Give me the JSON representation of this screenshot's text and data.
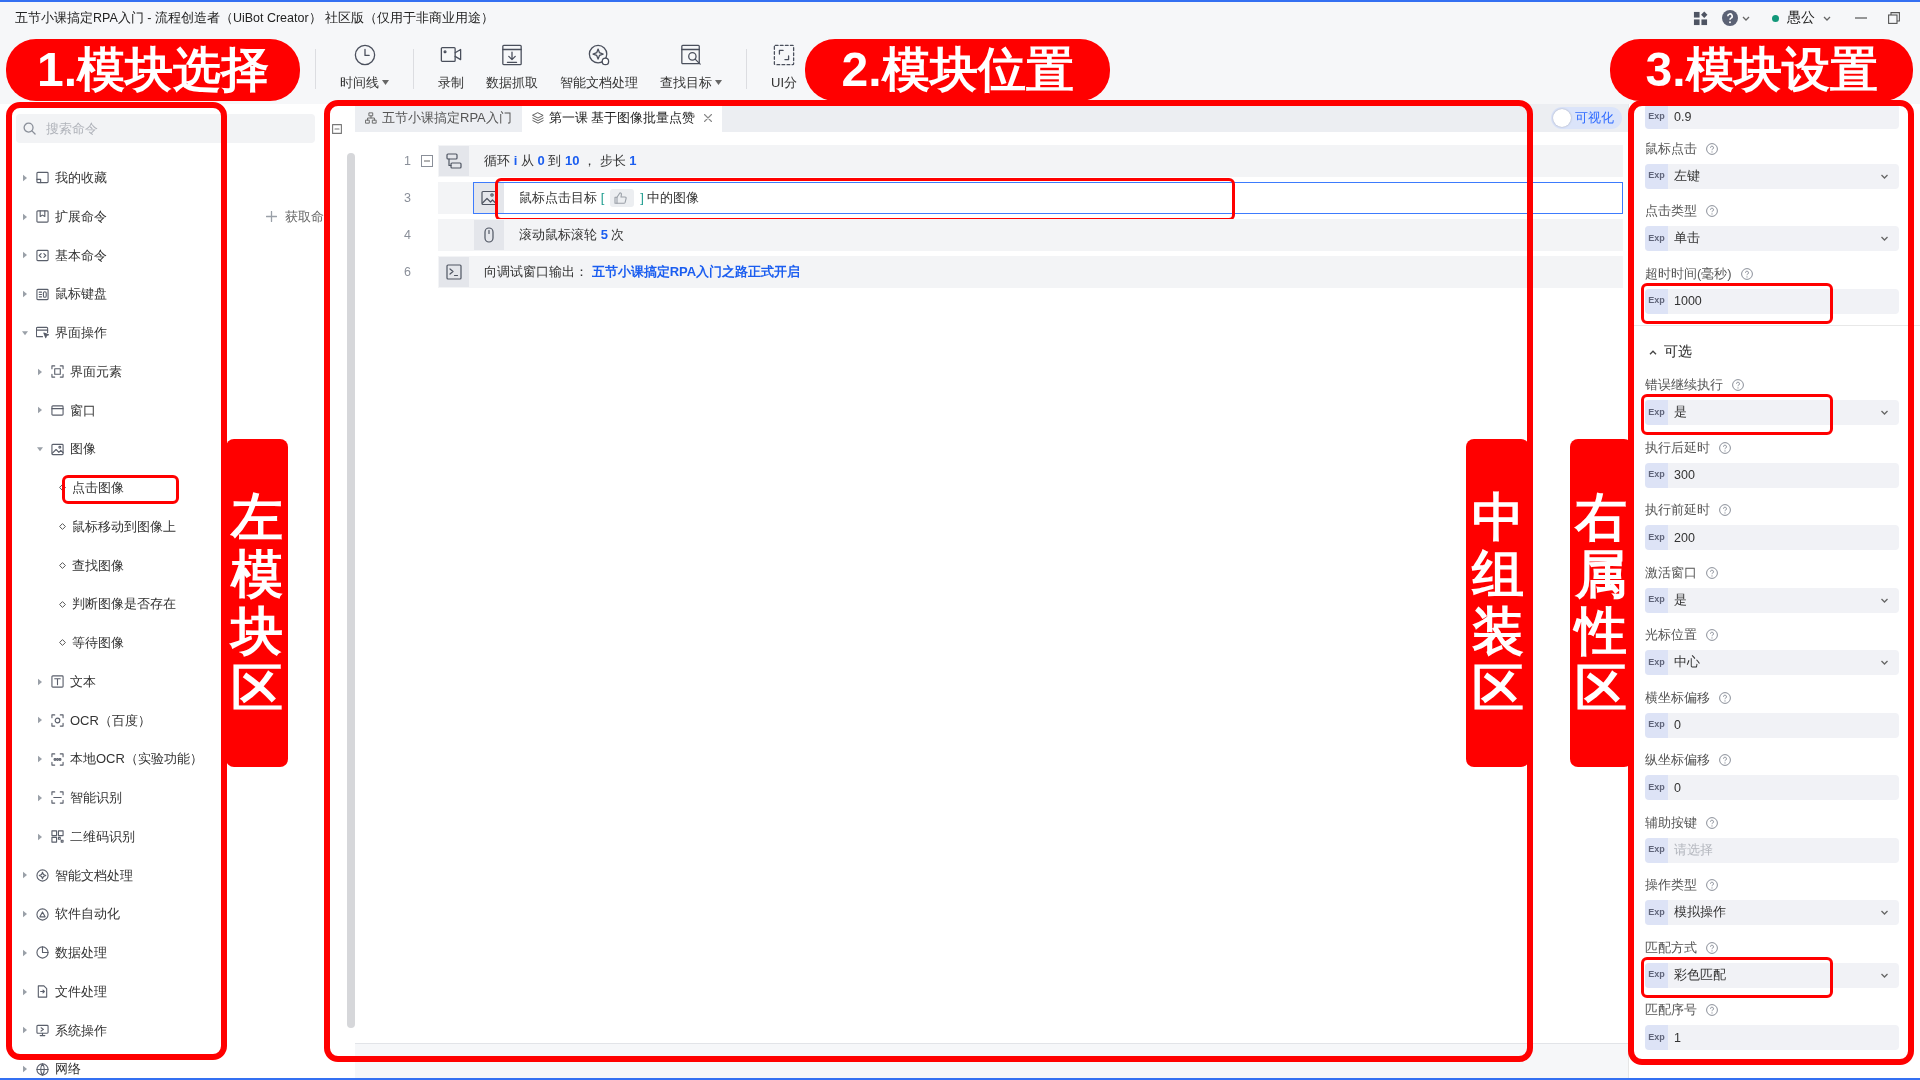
{
  "window": {
    "title": "五节小课搞定RPA入门 - 流程创造者（UiBot Creator） 社区版（仅用于非商业用途）",
    "user": {
      "name": "愚公",
      "online": true
    }
  },
  "toolbar": [
    {
      "items": [
        {
          "label": "时间线",
          "has_menu": true
        }
      ]
    },
    {
      "items": [
        {
          "label": "录制",
          "has_menu": false
        },
        {
          "label": "数据抓取",
          "has_menu": false
        },
        {
          "label": "智能文档处理",
          "has_menu": false
        },
        {
          "label": "查找目标",
          "has_menu": true
        }
      ]
    },
    {
      "items": [
        {
          "label": "UI分",
          "has_menu": false
        }
      ]
    }
  ],
  "sidebar": {
    "annotation": {
      "callout": "1.模块选择",
      "side_label": "左模块区"
    },
    "search": {
      "placeholder": "搜索命令"
    },
    "tree": [
      {
        "label": "我的收藏",
        "kind": "category",
        "expanded": false
      },
      {
        "label": "扩展命令",
        "kind": "category",
        "expanded": false,
        "action": "获取命"
      },
      {
        "label": "基本命令",
        "kind": "category",
        "expanded": false
      },
      {
        "label": "鼠标键盘",
        "kind": "category",
        "expanded": false
      },
      {
        "label": "界面操作",
        "kind": "category",
        "expanded": true,
        "children": [
          {
            "label": "界面元素",
            "kind": "category",
            "expanded": false
          },
          {
            "label": "窗口",
            "kind": "category",
            "expanded": false
          },
          {
            "label": "图像",
            "kind": "category",
            "expanded": true,
            "children": [
              {
                "label": "点击图像",
                "kind": "command",
                "highlighted": true
              },
              {
                "label": "鼠标移动到图像上",
                "kind": "command",
                "highlighted": false
              },
              {
                "label": "查找图像",
                "kind": "command",
                "highlighted": false
              },
              {
                "label": "判断图像是否存在",
                "kind": "command",
                "highlighted": false
              },
              {
                "label": "等待图像",
                "kind": "command",
                "highlighted": false
              }
            ]
          },
          {
            "label": "文本",
            "kind": "category",
            "expanded": false
          },
          {
            "label": "OCR（百度）",
            "kind": "category",
            "expanded": false
          },
          {
            "label": "本地OCR（实验功能）",
            "kind": "category",
            "expanded": false
          },
          {
            "label": "智能识别",
            "kind": "category",
            "expanded": false
          },
          {
            "label": "二维码识别",
            "kind": "category",
            "expanded": false
          }
        ]
      },
      {
        "label": "智能文档处理",
        "kind": "category",
        "expanded": false
      },
      {
        "label": "软件自动化",
        "kind": "category",
        "expanded": false
      },
      {
        "label": "数据处理",
        "kind": "category",
        "expanded": false
      },
      {
        "label": "文件处理",
        "kind": "category",
        "expanded": false
      },
      {
        "label": "系统操作",
        "kind": "category",
        "expanded": false
      },
      {
        "label": "网络",
        "kind": "category",
        "expanded": false
      }
    ]
  },
  "editor": {
    "annotation": {
      "callout": "2.模块位置",
      "side_label": "中组装区"
    },
    "tabs": [
      {
        "label": "五节小课搞定RPA入门",
        "kind": "flow",
        "selected": false
      },
      {
        "label": "第一课 基于图像批量点赞",
        "kind": "block",
        "selected": true
      }
    ],
    "visual_toggle": {
      "label": "可视化",
      "on": false
    },
    "lines": [
      {
        "number": "1",
        "kind": "loop",
        "expanded": true,
        "selected": false,
        "highlighted": false,
        "parts": [
          {
            "text": "循环 ",
            "kind": "plain"
          },
          {
            "text": "i",
            "kind": "value"
          },
          {
            "text": " 从 ",
            "kind": "plain"
          },
          {
            "text": "0",
            "kind": "value"
          },
          {
            "text": " 到 ",
            "kind": "plain"
          },
          {
            "text": "10",
            "kind": "value"
          },
          {
            "text": " ， 步长 ",
            "kind": "plain"
          },
          {
            "text": "1",
            "kind": "value"
          }
        ],
        "children": [
          {
            "number": "3",
            "kind": "image",
            "selected": true,
            "highlighted": true,
            "parts": [
              {
                "text": "鼠标点击目标 ",
                "kind": "plain"
              },
              {
                "text": "[",
                "kind": "bracket"
              },
              {
                "kind": "target"
              },
              {
                "text": "]",
                "kind": "bracket"
              },
              {
                "text": " 中的图像",
                "kind": "plain"
              }
            ]
          },
          {
            "number": "4",
            "kind": "mouse",
            "selected": false,
            "highlighted": false,
            "parts": [
              {
                "text": "滚动鼠标滚轮 ",
                "kind": "plain"
              },
              {
                "text": "5",
                "kind": "value"
              },
              {
                "text": " 次",
                "kind": "plain"
              }
            ]
          }
        ]
      },
      {
        "number": "6",
        "kind": "output",
        "selected": false,
        "highlighted": false,
        "parts": [
          {
            "text": "向调试窗口输出： ",
            "kind": "plain"
          },
          {
            "text": "五节小课搞定RPA入门之路正式开启",
            "kind": "value"
          }
        ]
      }
    ]
  },
  "properties": {
    "annotation": {
      "callout": "3.模块设置",
      "side_label": "右属性区"
    },
    "fields": [
      {
        "tag": "Exp",
        "value": "0.9",
        "kind": "input",
        "highlighted": false
      },
      {
        "label": "鼠标点击",
        "tag": "Exp",
        "value": "左键",
        "kind": "select",
        "highlighted": false
      },
      {
        "label": "点击类型",
        "tag": "Exp",
        "value": "单击",
        "kind": "select",
        "highlighted": false
      },
      {
        "label": "超时时间(毫秒)",
        "tag": "Exp",
        "value": "1000",
        "kind": "input",
        "highlighted": true
      }
    ],
    "optional": {
      "title": "可选",
      "expanded": true,
      "fields": [
        {
          "label": "错误继续执行",
          "tag": "Exp",
          "value": "是",
          "kind": "select",
          "highlighted": true
        },
        {
          "label": "执行后延时",
          "tag": "Exp",
          "value": "300",
          "kind": "input",
          "highlighted": false
        },
        {
          "label": "执行前延时",
          "tag": "Exp",
          "value": "200",
          "kind": "input",
          "highlighted": false
        },
        {
          "label": "激活窗口",
          "tag": "Exp",
          "value": "是",
          "kind": "select",
          "highlighted": false
        },
        {
          "label": "光标位置",
          "tag": "Exp",
          "value": "中心",
          "kind": "select",
          "highlighted": false
        },
        {
          "label": "横坐标偏移",
          "tag": "Exp",
          "value": "0",
          "kind": "input",
          "highlighted": false
        },
        {
          "label": "纵坐标偏移",
          "tag": "Exp",
          "value": "0",
          "kind": "input",
          "highlighted": false
        },
        {
          "label": "辅助按键",
          "tag": "Exp",
          "placeholder": "请选择",
          "kind": "input",
          "highlighted": false
        },
        {
          "label": "操作类型",
          "tag": "Exp",
          "value": "模拟操作",
          "kind": "select",
          "highlighted": false
        },
        {
          "label": "匹配方式",
          "tag": "Exp",
          "value": "彩色匹配",
          "kind": "select",
          "highlighted": true
        },
        {
          "label": "匹配序号",
          "tag": "Exp",
          "value": "1",
          "kind": "input",
          "highlighted": false
        }
      ]
    }
  }
}
